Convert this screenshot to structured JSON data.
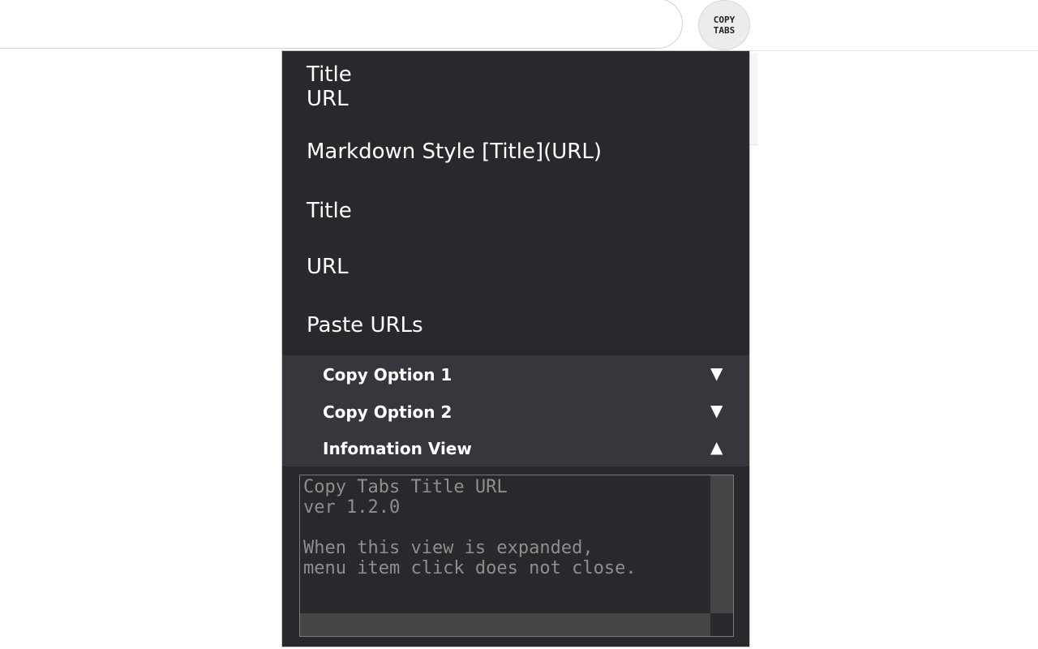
{
  "toolbar": {
    "extension_icon_text": [
      "COPY",
      "TABS"
    ]
  },
  "menu": {
    "items": [
      {
        "lines": [
          "Title",
          "URL"
        ]
      },
      {
        "lines": [
          "Markdown Style [Title](URL)"
        ]
      },
      {
        "lines": [
          "Title"
        ]
      },
      {
        "lines": [
          "URL"
        ]
      },
      {
        "lines": [
          "Paste URLs"
        ]
      }
    ]
  },
  "options": [
    {
      "label": "Copy Option 1",
      "arrow": "▼",
      "expanded": false
    },
    {
      "label": "Copy Option 2",
      "arrow": "▼",
      "expanded": false
    },
    {
      "label": "Infomation View",
      "arrow": "▲",
      "expanded": true
    }
  ],
  "info_view": {
    "text": "Copy Tabs Title URL\nver 1.2.0\n\nWhen this view is expanded,\nmenu item click does not close."
  }
}
